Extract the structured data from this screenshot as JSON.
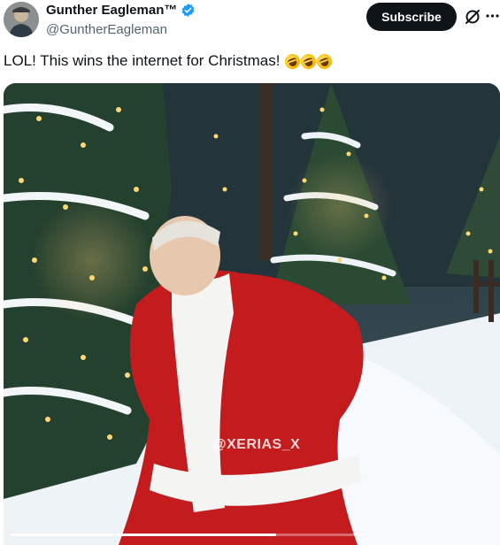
{
  "author": {
    "name": "Gunther Eagleman™",
    "handle": "@GuntherEagleman",
    "verified": true,
    "verified_color": "#1d9bf0"
  },
  "actions": {
    "subscribe_label": "Subscribe",
    "grok_icon": "slashed-circle-icon",
    "more_icon": "more-horizontal-icon"
  },
  "tweet": {
    "text": "LOL!  This wins the internet for Christmas!",
    "emojis": [
      "rolling-on-floor-laughing",
      "rolling-on-floor-laughing",
      "rolling-on-floor-laughing"
    ]
  },
  "media": {
    "type": "video",
    "watermark": "@XERIAS_X",
    "progress": 0.55
  },
  "colors": {
    "text_primary": "#0f1419",
    "text_secondary": "#536471",
    "button_bg": "#0f1419",
    "button_text": "#ffffff"
  }
}
